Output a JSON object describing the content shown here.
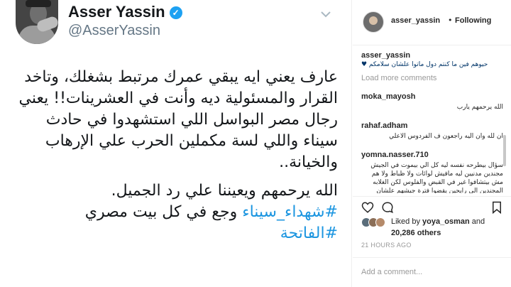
{
  "tweet": {
    "name": "Asser Yassin",
    "handle": "@AsserYassin",
    "lines": [
      "عارف يعني ايه يبقي عمرك مرتبط بشغلك، وتاخد",
      "القرار والمسئولية ديه وأنت في العشرينات!! يعني",
      "رجال مصر البواسل اللي استشهدوا في حادث",
      "سيناء واللي لسة مكملين الحرب علي الإرهاب",
      "والخيانة.."
    ],
    "prayer": "الله يرحمهم ويعيننا علي رد الجميل.",
    "hashtag1": "#شهداء_سيناء",
    "hashtag1_suffix": "وجع في كل بيت مصري",
    "hashtag2": "#الفاتحة"
  },
  "post": {
    "username": "asser_yassin",
    "separator": "•",
    "follow_label": "Following",
    "caption_user": "asser_yassin",
    "caption_text": "حيوهم فين ما كنتم دول ماتوا علشان سلامكم ♥",
    "load_more": "Load more comments",
    "comments": [
      {
        "user": "moka_mayosh",
        "text": "الله يرحمهم يارب"
      },
      {
        "user": "rahaf.adham",
        "text": "ان لله وان اليه راجعون ف الفردوس الاعلي"
      },
      {
        "user": "yomna.nasser.710",
        "text": "سؤال بيطرحه نفسه ليه كل الي بيموت في الجيش مجندين مدنيين ليه مافيش لوائات ولا ظباط ولا هم مش بيتشافوا غير في القبض والفلوس لكن الغلابه المجندين الي رايحين يقضوا فترة جيشهم علشان يخلصوا منها ويبتشوا يشوفوا حياتهم هما الي بيموتوا ومطلوب مننا اننا نقول ضحوا"
      }
    ],
    "liked_by_prefix": "Liked by",
    "liked_by_user": "yoya_osman",
    "liked_by_and": "and",
    "liked_by_count": "20,286 others",
    "timestamp": "21 HOURS AGO",
    "comment_placeholder": "Add a comment..."
  },
  "colors": {
    "link_blue": "#1b95e0",
    "verified_blue": "#1da1f2",
    "muted_gray": "#999999"
  },
  "icons": [
    "verified-badge-icon",
    "chevron-down-icon",
    "heart-icon",
    "comment-icon",
    "bookmark-icon"
  ]
}
